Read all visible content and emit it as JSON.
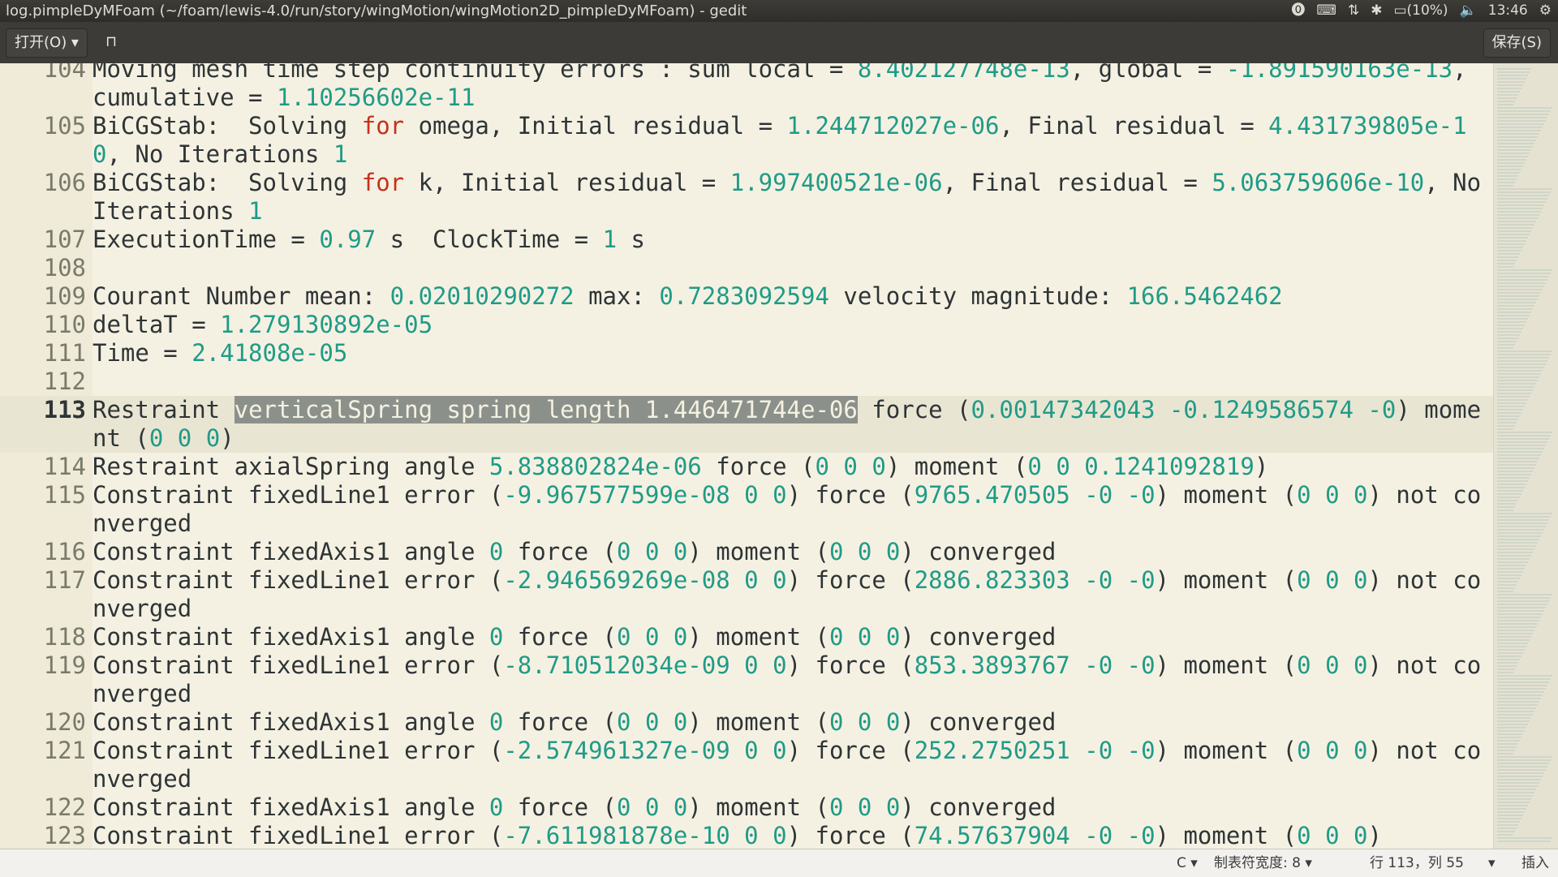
{
  "window": {
    "title": "log.pimpleDyMFoam (~/foam/lewis-4.0/run/story/wingMotion/wingMotion2D_pimpleDyMFoam) - gedit"
  },
  "tray": {
    "battery": "(10%)",
    "clock": "13:46"
  },
  "toolbar": {
    "open_label": "打开(O) ▾",
    "save_label": "保存(S)"
  },
  "editor": {
    "lines": [
      {
        "n": "104",
        "html": "Moving mesh time step continuity errors : sum local = <span class=\"num\">8.402127748e-13</span>, global = <span class=\"num\">-1.891590163e-13</span>, cumulative = <span class=\"num\">1.10256602e-11</span>"
      },
      {
        "n": "105",
        "html": "BiCGStab:  Solving <span class=\"kw\">for</span> omega, Initial residual = <span class=\"num\">1.244712027e-06</span>, Final residual = <span class=\"num\">4.431739805e-10</span>, No Iterations <span class=\"num\">1</span>"
      },
      {
        "n": "106",
        "html": "BiCGStab:  Solving <span class=\"kw\">for</span> k, Initial residual = <span class=\"num\">1.997400521e-06</span>, Final residual = <span class=\"num\">5.063759606e-10</span>, No Iterations <span class=\"num\">1</span>"
      },
      {
        "n": "107",
        "html": "ExecutionTime = <span class=\"num\">0.97</span> s  ClockTime = <span class=\"num\">1</span> s"
      },
      {
        "n": "108",
        "html": ""
      },
      {
        "n": "109",
        "html": "Courant Number mean: <span class=\"num\">0.02010290272</span> max: <span class=\"num\">0.7283092594</span> velocity magnitude: <span class=\"num\">166.5462462</span>"
      },
      {
        "n": "110",
        "html": "deltaT = <span class=\"num\">1.279130892e-05</span>"
      },
      {
        "n": "111",
        "html": "Time = <span class=\"num\">2.41808e-05</span>"
      },
      {
        "n": "112",
        "html": ""
      },
      {
        "n": "113",
        "current": true,
        "html": "Restraint <span class=\"sel\">verticalSpring spring length 1.446471744e-06</span> force (<span class=\"num\">0.00147342043</span> <span class=\"num\">-0.1249586574</span> <span class=\"num\">-0</span>) moment (<span class=\"num\">0</span> <span class=\"num\">0</span> <span class=\"num\">0</span>)"
      },
      {
        "n": "114",
        "html": "Restraint axialSpring angle <span class=\"num\">5.838802824e-06</span> force (<span class=\"num\">0</span> <span class=\"num\">0</span> <span class=\"num\">0</span>) moment (<span class=\"num\">0</span> <span class=\"num\">0</span> <span class=\"num\">0.1241092819</span>)"
      },
      {
        "n": "115",
        "html": "Constraint fixedLine1 error (<span class=\"num\">-9.967577599e-08</span> <span class=\"num\">0</span> <span class=\"num\">0</span>) force (<span class=\"num\">9765.470505</span> <span class=\"num\">-0</span> <span class=\"num\">-0</span>) moment (<span class=\"num\">0</span> <span class=\"num\">0</span> <span class=\"num\">0</span>) not converged"
      },
      {
        "n": "116",
        "html": "Constraint fixedAxis1 angle <span class=\"num\">0</span> force (<span class=\"num\">0</span> <span class=\"num\">0</span> <span class=\"num\">0</span>) moment (<span class=\"num\">0</span> <span class=\"num\">0</span> <span class=\"num\">0</span>) converged"
      },
      {
        "n": "117",
        "html": "Constraint fixedLine1 error (<span class=\"num\">-2.946569269e-08</span> <span class=\"num\">0</span> <span class=\"num\">0</span>) force (<span class=\"num\">2886.823303</span> <span class=\"num\">-0</span> <span class=\"num\">-0</span>) moment (<span class=\"num\">0</span> <span class=\"num\">0</span> <span class=\"num\">0</span>) not converged"
      },
      {
        "n": "118",
        "html": "Constraint fixedAxis1 angle <span class=\"num\">0</span> force (<span class=\"num\">0</span> <span class=\"num\">0</span> <span class=\"num\">0</span>) moment (<span class=\"num\">0</span> <span class=\"num\">0</span> <span class=\"num\">0</span>) converged"
      },
      {
        "n": "119",
        "html": "Constraint fixedLine1 error (<span class=\"num\">-8.710512034e-09</span> <span class=\"num\">0</span> <span class=\"num\">0</span>) force (<span class=\"num\">853.3893767</span> <span class=\"num\">-0</span> <span class=\"num\">-0</span>) moment (<span class=\"num\">0</span> <span class=\"num\">0</span> <span class=\"num\">0</span>) not converged"
      },
      {
        "n": "120",
        "html": "Constraint fixedAxis1 angle <span class=\"num\">0</span> force (<span class=\"num\">0</span> <span class=\"num\">0</span> <span class=\"num\">0</span>) moment (<span class=\"num\">0</span> <span class=\"num\">0</span> <span class=\"num\">0</span>) converged"
      },
      {
        "n": "121",
        "html": "Constraint fixedLine1 error (<span class=\"num\">-2.574961327e-09</span> <span class=\"num\">0</span> <span class=\"num\">0</span>) force (<span class=\"num\">252.2750251</span> <span class=\"num\">-0</span> <span class=\"num\">-0</span>) moment (<span class=\"num\">0</span> <span class=\"num\">0</span> <span class=\"num\">0</span>) not converged"
      },
      {
        "n": "122",
        "html": "Constraint fixedAxis1 angle <span class=\"num\">0</span> force (<span class=\"num\">0</span> <span class=\"num\">0</span> <span class=\"num\">0</span>) moment (<span class=\"num\">0</span> <span class=\"num\">0</span> <span class=\"num\">0</span>) converged"
      },
      {
        "n": "123",
        "html": "Constraint fixedLine1 error (<span class=\"num\">-7.611981878e-10</span> <span class=\"num\">0</span> <span class=\"num\">0</span>) force (<span class=\"num\">74.57637904</span> <span class=\"num\">-0</span> <span class=\"num\">-0</span>) moment (<span class=\"num\">0</span> <span class=\"num\">0</span> <span class=\"num\">0</span>)"
      }
    ]
  },
  "statusbar": {
    "language": "C ▾",
    "tab_width": "制表符宽度: 8 ▾",
    "position": "行 113，列 55",
    "mode_dropdown": "▾",
    "insert_mode": "插入"
  },
  "colors": {
    "number": "#1f9b88",
    "keyword": "#c4321c",
    "selection": "#8b918a",
    "background": "#f5f1e2"
  }
}
